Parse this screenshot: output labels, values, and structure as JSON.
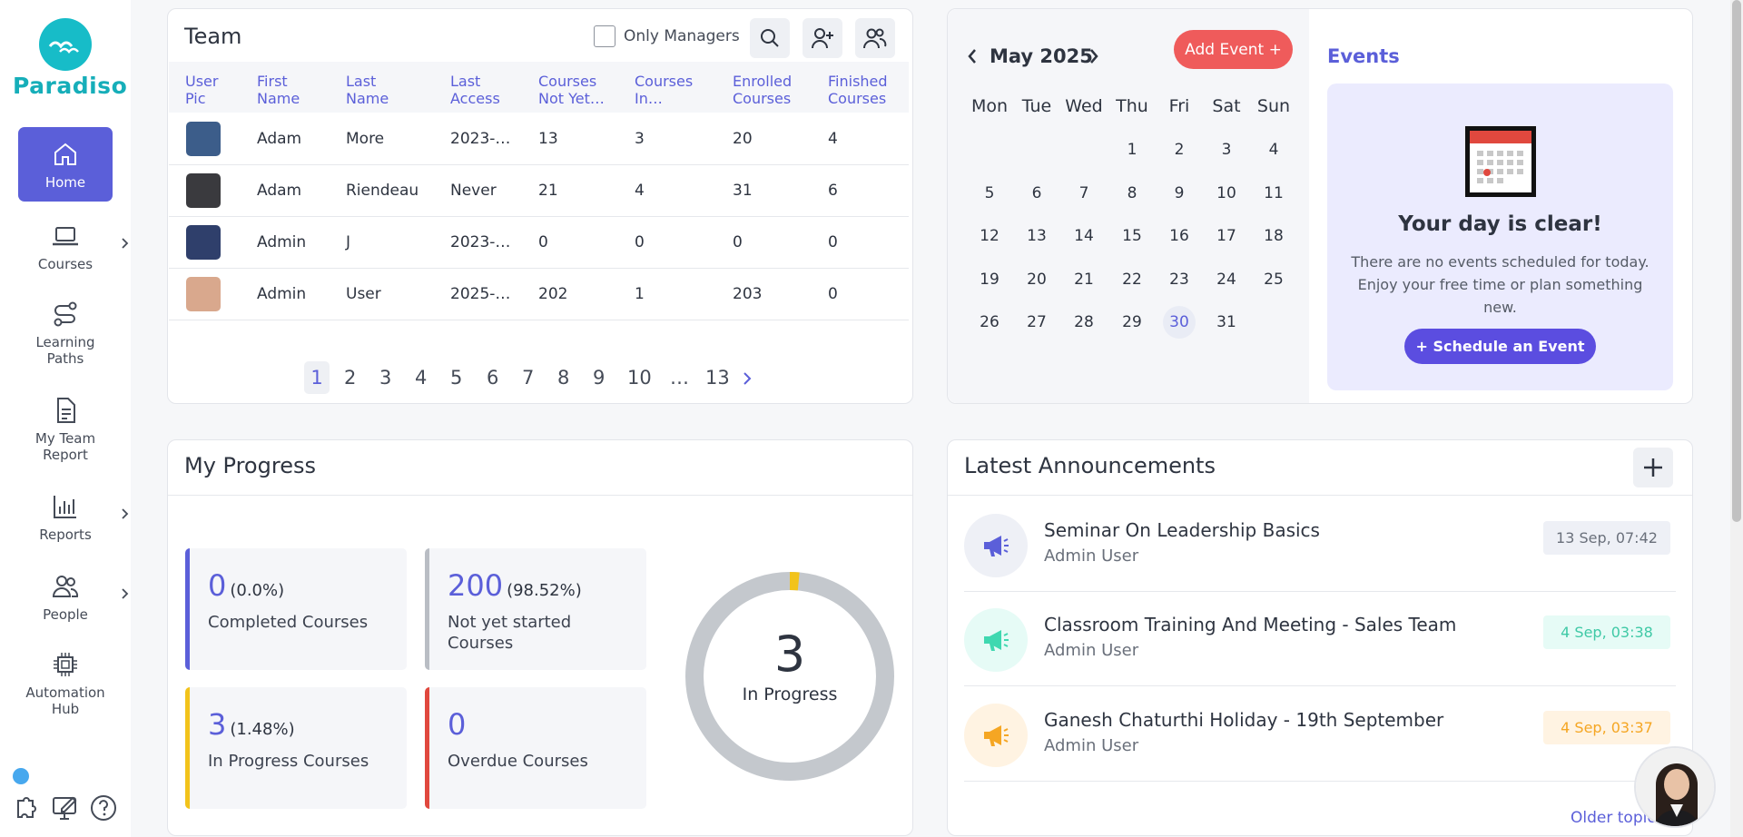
{
  "brand": {
    "name": "Paradiso",
    "color": "#17bcc8"
  },
  "sidebar": {
    "items": [
      {
        "label": "Home",
        "icon": "home-icon",
        "active": true
      },
      {
        "label": "Courses",
        "icon": "laptop-icon",
        "has_submenu": true
      },
      {
        "label": "Learning Paths",
        "icon": "route-icon"
      },
      {
        "label": "My Team Report",
        "icon": "document-icon"
      },
      {
        "label": "Reports",
        "icon": "bar-chart-icon",
        "has_submenu": true
      },
      {
        "label": "People",
        "icon": "people-icon",
        "has_submenu": true
      },
      {
        "label": "Automation Hub",
        "icon": "chip-icon"
      }
    ],
    "bottom_icons": [
      "puzzle-settings-icon",
      "monitor-edit-icon",
      "help-icon"
    ]
  },
  "team": {
    "title": "Team",
    "only_managers_label": "Only Managers",
    "columns": [
      "User Pic",
      "First Name",
      "Last Name",
      "Last Access",
      "Courses Not Yet…",
      "Courses In…",
      "Enrolled Courses",
      "Finished Courses"
    ],
    "rows": [
      {
        "first": "Adam",
        "last": "More",
        "access": "2023-…",
        "not_yet": "13",
        "in_prog": "3",
        "enrolled": "20",
        "finished": "4"
      },
      {
        "first": "Adam",
        "last": "Riendeau",
        "access": "Never",
        "not_yet": "21",
        "in_prog": "4",
        "enrolled": "31",
        "finished": "6"
      },
      {
        "first": "Admin",
        "last": "J",
        "access": "2023-…",
        "not_yet": "0",
        "in_prog": "0",
        "enrolled": "0",
        "finished": "0"
      },
      {
        "first": "Admin",
        "last": "User",
        "access": "2025-…",
        "not_yet": "202",
        "in_prog": "1",
        "enrolled": "203",
        "finished": "0"
      }
    ],
    "pages": [
      "1",
      "2",
      "3",
      "4",
      "5",
      "6",
      "7",
      "8",
      "9",
      "10",
      "…",
      "13"
    ],
    "current_page": "1"
  },
  "calendar": {
    "month_label": "May 2025",
    "add_event_label": "Add Event +",
    "weekdays": [
      "Mon",
      "Tue",
      "Wed",
      "Thu",
      "Fri",
      "Sat",
      "Sun"
    ],
    "weeks": [
      [
        "",
        "",
        "",
        "1",
        "2",
        "3",
        "4"
      ],
      [
        "5",
        "6",
        "7",
        "8",
        "9",
        "10",
        "11"
      ],
      [
        "12",
        "13",
        "14",
        "15",
        "16",
        "17",
        "18"
      ],
      [
        "19",
        "20",
        "21",
        "22",
        "23",
        "24",
        "25"
      ],
      [
        "26",
        "27",
        "28",
        "29",
        "30",
        "31",
        ""
      ]
    ],
    "today": "30"
  },
  "events": {
    "title": "Events",
    "empty_title": "Your day is clear!",
    "empty_text": "There are no events scheduled for today. Enjoy your free time or plan something new.",
    "schedule_label": "+ Schedule an Event"
  },
  "progress": {
    "title": "My Progress",
    "stats": [
      {
        "value": "0",
        "pct": "(0.0%)",
        "label": "Completed Courses",
        "color": "#5b5fd9"
      },
      {
        "value": "200",
        "pct": "(98.52%)",
        "label": "Not yet started Courses",
        "color": "#b9bdc4"
      },
      {
        "value": "3",
        "pct": "(1.48%)",
        "label": "In Progress Courses",
        "color": "#f2c31b"
      },
      {
        "value": "0",
        "pct": "",
        "label": "Overdue Courses",
        "color": "#e0483e"
      }
    ],
    "donut": {
      "number": "3",
      "label": "In Progress",
      "in_progress_fraction": 0.0148
    }
  },
  "announcements": {
    "title": "Latest Announcements",
    "items": [
      {
        "title": "Seminar On Leadership Basics",
        "by": "Admin User",
        "date": "13 Sep, 07:42",
        "accent": "#5b5fd9",
        "bg": "#eef0f6",
        "date_bg": "#eef0f6",
        "date_color": "#6a707b"
      },
      {
        "title": "Classroom Training And Meeting - Sales Team",
        "by": "Admin User",
        "date": "4 Sep, 03:38",
        "accent": "#3fd8b0",
        "bg": "#e6fbf6",
        "date_bg": "#e6fbf6",
        "date_color": "#3fc9a6"
      },
      {
        "title": "Ganesh Chaturthi Holiday - 19th September",
        "by": "Admin User",
        "date": "4 Sep, 03:37",
        "accent": "#f5a623",
        "bg": "#fff3e2",
        "date_bg": "#fff3e2",
        "date_color": "#f5a623"
      }
    ],
    "older_label": "Older topics"
  }
}
